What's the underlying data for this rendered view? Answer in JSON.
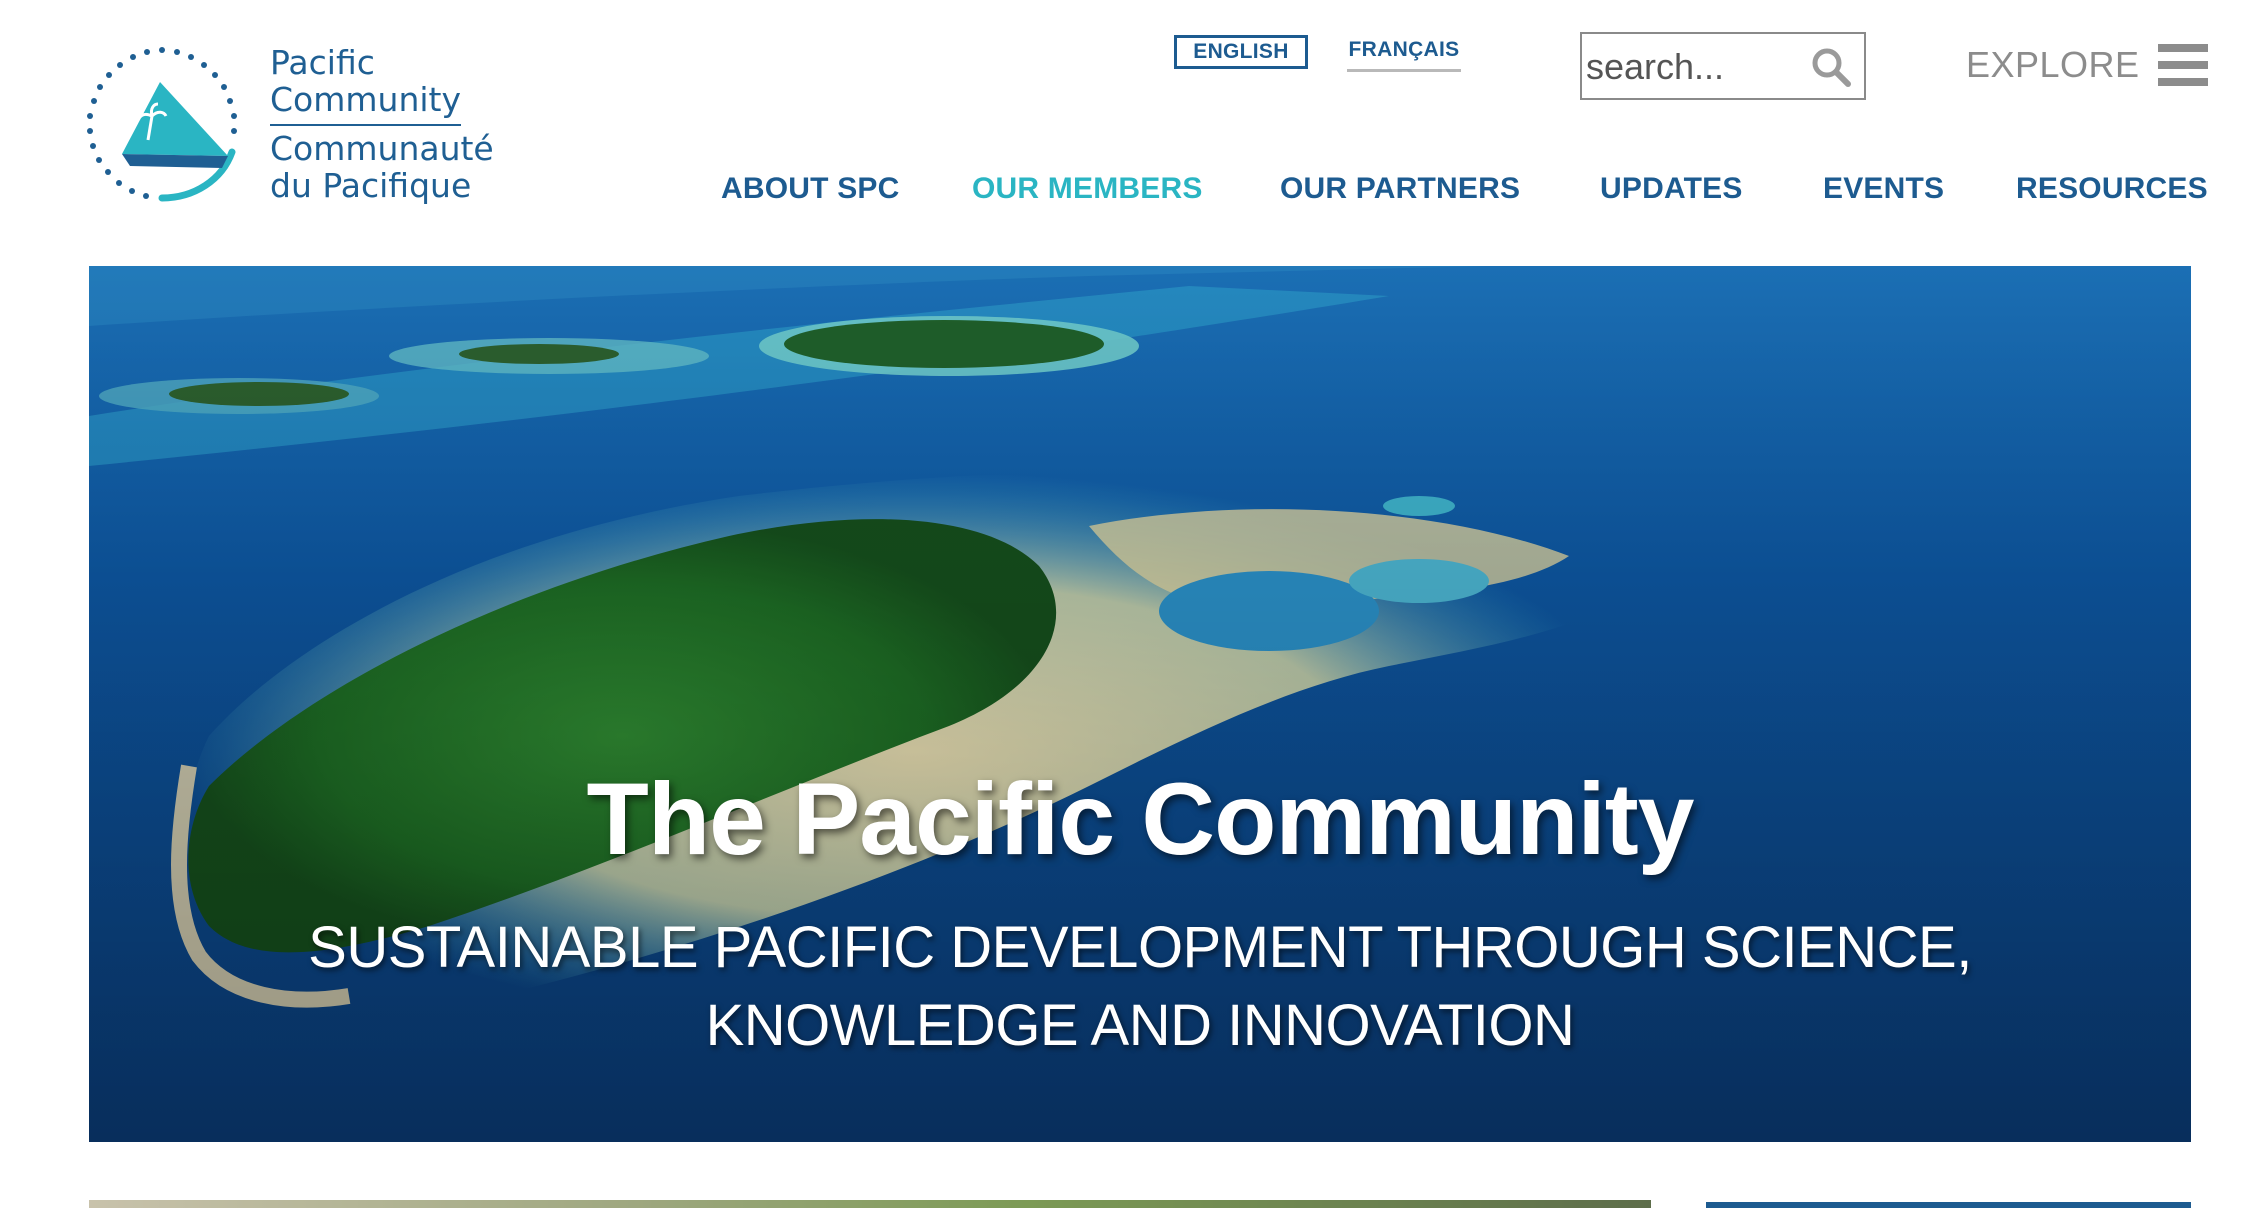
{
  "brand": {
    "name_en_line1": "Pacific",
    "name_en_line2": "Community",
    "name_fr_line1": "Communauté",
    "name_fr_line2": "du Pacifique",
    "logo_icon": "sailboat-star-ring-icon"
  },
  "language": {
    "english": "ENGLISH",
    "french": "FRANÇAIS",
    "selected": "ENGLISH"
  },
  "search": {
    "placeholder": "search...",
    "icon": "magnifier-icon"
  },
  "explore": {
    "label": "EXPLORE",
    "icon": "hamburger-icon"
  },
  "nav": {
    "items": [
      {
        "label": "ABOUT SPC"
      },
      {
        "label": "OUR MEMBERS",
        "active": true
      },
      {
        "label": "OUR PARTNERS"
      },
      {
        "label": "UPDATES"
      },
      {
        "label": "EVENTS"
      },
      {
        "label": "RESOURCES"
      }
    ]
  },
  "hero": {
    "title": "The Pacific Community",
    "subtitle_line1": "SUSTAINABLE PACIFIC DEVELOPMENT THROUGH SCIENCE,",
    "subtitle_line2": "KNOWLEDGE AND INNOVATION"
  },
  "colors": {
    "primary": "#1d5b90",
    "accent": "#2ab5c3",
    "explore_gray": "#8c8c8c"
  }
}
